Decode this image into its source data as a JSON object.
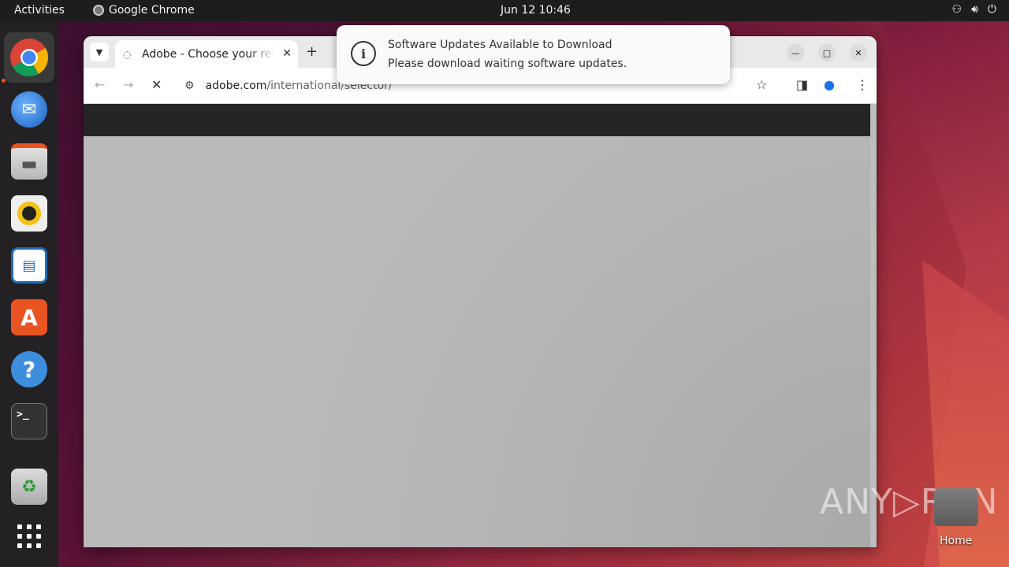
{
  "topbar": {
    "activities": "Activities",
    "app_name": "Google Chrome",
    "clock": "Jun 12  10:46",
    "tray": [
      "network-icon",
      "volume-icon",
      "power-icon"
    ]
  },
  "dock": {
    "items": [
      {
        "name": "chrome",
        "icon": "chrome-icon"
      },
      {
        "name": "thunderbird",
        "icon": "thunderbird-icon"
      },
      {
        "name": "files",
        "icon": "files-icon"
      },
      {
        "name": "rhythmbox",
        "icon": "rhythmbox-icon"
      },
      {
        "name": "writer",
        "icon": "libreoffice-writer-icon"
      },
      {
        "name": "software",
        "icon": "app-center-icon"
      },
      {
        "name": "help",
        "icon": "help-icon"
      },
      {
        "name": "terminal",
        "icon": "terminal-icon"
      },
      {
        "name": "trash",
        "icon": "trash-icon"
      },
      {
        "name": "apps",
        "icon": "app-grid-icon"
      }
    ]
  },
  "browser": {
    "tab_title": "Adobe - Choose your region",
    "url_host": "adobe.com",
    "url_path": "/international/selector/"
  },
  "notification": {
    "title": "Software Updates Available to Download",
    "body": "Please download waiting software updates."
  },
  "desktop": {
    "home_label": "Home",
    "watermark": "ANY▷RUN"
  },
  "colors": {
    "accent": "#e95420",
    "topbar": "#1d1d1d",
    "dock": "#232123"
  }
}
